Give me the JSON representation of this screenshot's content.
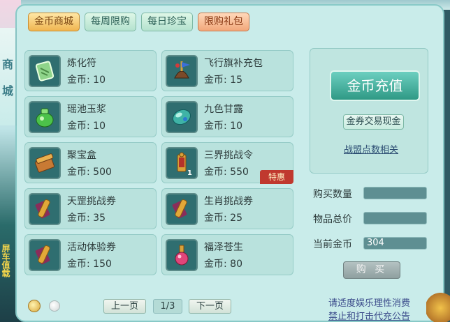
{
  "side": {
    "title_chars": [
      "商",
      "城"
    ],
    "deco_text": "屏车值载"
  },
  "tabs": [
    {
      "label": "金币商城",
      "active": true
    },
    {
      "label": "每周限购",
      "active": false
    },
    {
      "label": "每日珍宝",
      "active": false
    },
    {
      "label": "限购礼包",
      "active": false
    }
  ],
  "items": [
    {
      "name": "炼化符",
      "price": "金币: 10",
      "icon": "scroll-charm-icon"
    },
    {
      "name": "飞行旗补充包",
      "price": "金币: 15",
      "icon": "flag-pouch-icon"
    },
    {
      "name": "瑶池玉浆",
      "price": "金币: 10",
      "icon": "jade-jar-icon"
    },
    {
      "name": "九色甘露",
      "price": "金币: 10",
      "icon": "dew-gem-icon"
    },
    {
      "name": "聚宝盒",
      "price": "金币: 500",
      "icon": "treasure-box-icon"
    },
    {
      "name": "三界挑战令",
      "price": "金币: 550",
      "icon": "challenge-token-icon",
      "badge": "特惠",
      "count": "1"
    },
    {
      "name": "天罡挑战券",
      "price": "金币: 35",
      "icon": "scroll-ticket-icon"
    },
    {
      "name": "生肖挑战券",
      "price": "金币: 25",
      "icon": "scroll-ticket-icon"
    },
    {
      "name": "活动体验券",
      "price": "金币: 150",
      "icon": "scroll-ticket-icon"
    },
    {
      "name": "福泽苍生",
      "price": "金币: 80",
      "icon": "potion-bottle-icon"
    }
  ],
  "right": {
    "recharge_label": "金币充值",
    "coupon_label": "金券交易现金",
    "alliance_label": "战盟点数相关",
    "quantity_label": "购买数量",
    "quantity_value": "",
    "total_label": "物品总价",
    "total_value": "",
    "balance_label": "当前金币",
    "balance_value": "304",
    "buy_label": "购 买"
  },
  "pager": {
    "prev_label": "上一页",
    "page_text": "1/3",
    "next_label": "下一页"
  },
  "notice": {
    "line1": "请适度娱乐理性消费",
    "line2": "禁止和打击代充公告"
  },
  "colors": {
    "panel_bg": "#c9ecea",
    "accent_gold": "#f0b550",
    "badge_red": "#c0392f",
    "recharge_teal": "#2f9985"
  }
}
